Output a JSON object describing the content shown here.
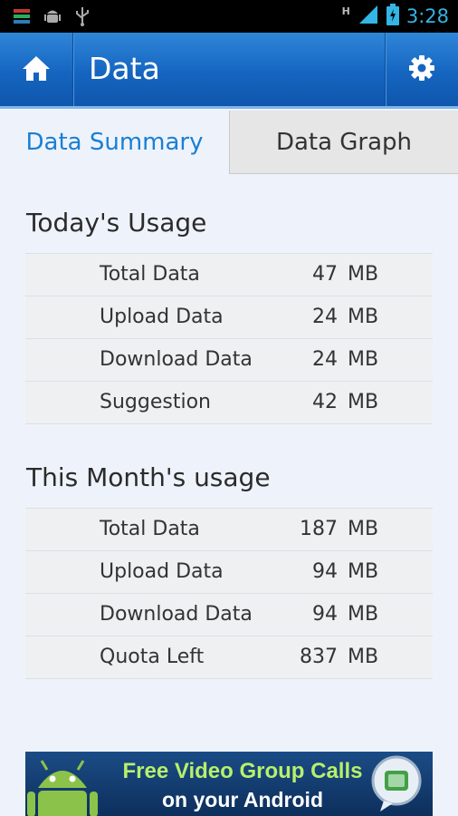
{
  "status_bar": {
    "time": "3:28",
    "network_label": "H",
    "icons": [
      "app-notification-icon",
      "android-debug-icon",
      "usb-icon",
      "signal-icon",
      "battery-charging-icon"
    ]
  },
  "action_bar": {
    "title": "Data",
    "home_icon": "home-icon",
    "settings_icon": "gear-icon"
  },
  "tabs": [
    {
      "label": "Data Summary",
      "active": true
    },
    {
      "label": "Data Graph",
      "active": false
    }
  ],
  "today": {
    "title": "Today's Usage",
    "rows": [
      {
        "label": "Total Data",
        "value": "47",
        "unit": "MB"
      },
      {
        "label": "Upload Data",
        "value": "24",
        "unit": "MB"
      },
      {
        "label": "Download Data",
        "value": "24",
        "unit": "MB"
      },
      {
        "label": "Suggestion",
        "value": "42",
        "unit": "MB"
      }
    ]
  },
  "month": {
    "title": "This Month's usage",
    "rows": [
      {
        "label": "Total Data",
        "value": "187",
        "unit": "MB"
      },
      {
        "label": "Upload Data",
        "value": "94",
        "unit": "MB"
      },
      {
        "label": "Download Data",
        "value": "94",
        "unit": "MB"
      },
      {
        "label": "Quota Left",
        "value": "837",
        "unit": "MB"
      }
    ]
  },
  "ad": {
    "line1": "Free Video Group Calls",
    "line2": "on your Android"
  },
  "colors": {
    "accent": "#1a7fd4",
    "action_bar": "#1565c0",
    "status_icons": "#33b5e5"
  }
}
